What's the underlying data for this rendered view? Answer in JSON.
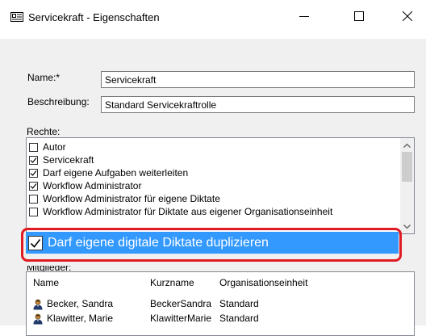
{
  "window": {
    "title": "Servicekraft - Eigenschaften"
  },
  "form": {
    "name_label": "Name:*",
    "name_value": "Servicekraft",
    "description_label": "Beschreibung:",
    "description_value": "Standard Servicekraftrolle",
    "rights_label": "Rechte:",
    "members_label": "Mitglieder:"
  },
  "rights": [
    {
      "label": "Autor",
      "checked": false
    },
    {
      "label": "Servicekraft",
      "checked": true
    },
    {
      "label": "Darf eigene Aufgaben weiterleiten",
      "checked": true
    },
    {
      "label": "Workflow Administrator",
      "checked": true
    },
    {
      "label": "Workflow Administrator für eigene Diktate",
      "checked": false
    },
    {
      "label": "Workflow Administrator für Diktate aus eigener Organisationseinheit",
      "checked": false
    }
  ],
  "highlighted_right": {
    "label": "Darf eigene digitale Diktate duplizieren",
    "checked": true
  },
  "members": {
    "columns": [
      "Name",
      "Kurzname",
      "Organisationseinheit"
    ],
    "rows": [
      {
        "name": "Becker, Sandra",
        "short": "BeckerSandra",
        "unit": "Standard"
      },
      {
        "name": "Klawitter, Marie",
        "short": "KlawitterMarie",
        "unit": "Standard"
      }
    ]
  },
  "colors": {
    "selection": "#3399ff",
    "callout": "#e01b24",
    "dialog_bg": "#f0f0f0"
  }
}
